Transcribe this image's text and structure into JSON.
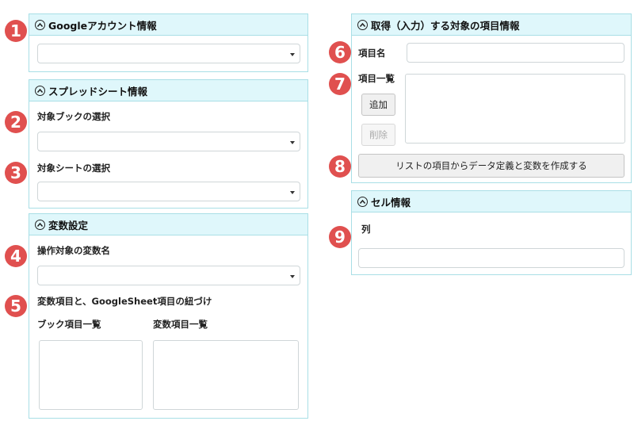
{
  "account_panel": {
    "title": "Googleアカウント情報"
  },
  "spreadsheet_panel": {
    "title": "スプレッドシート情報",
    "book_label": "対象ブックの選択",
    "sheet_label": "対象シートの選択"
  },
  "variable_panel": {
    "title": "変数設定",
    "var_label": "操作対象の変数名",
    "mapping_label": "変数項目と、GoogleSheet項目の紐づけ",
    "book_items_label": "ブック項目一覧",
    "var_items_label": "変数項目一覧"
  },
  "target_panel": {
    "title": "取得（入力）する対象の項目情報",
    "item_name_label": "項目名",
    "item_list_label": "項目一覧",
    "add_button": "追加",
    "delete_button": "削除",
    "create_button": "リストの項目からデータ定義と変数を作成する"
  },
  "cell_panel": {
    "title": "セル情報",
    "column_label": "列"
  },
  "markers": [
    "1",
    "2",
    "3",
    "4",
    "5",
    "6",
    "7",
    "8",
    "9"
  ],
  "colors": {
    "header_bg": "#dff7fb",
    "border": "#a9dfe6",
    "marker": "#e0504f"
  }
}
